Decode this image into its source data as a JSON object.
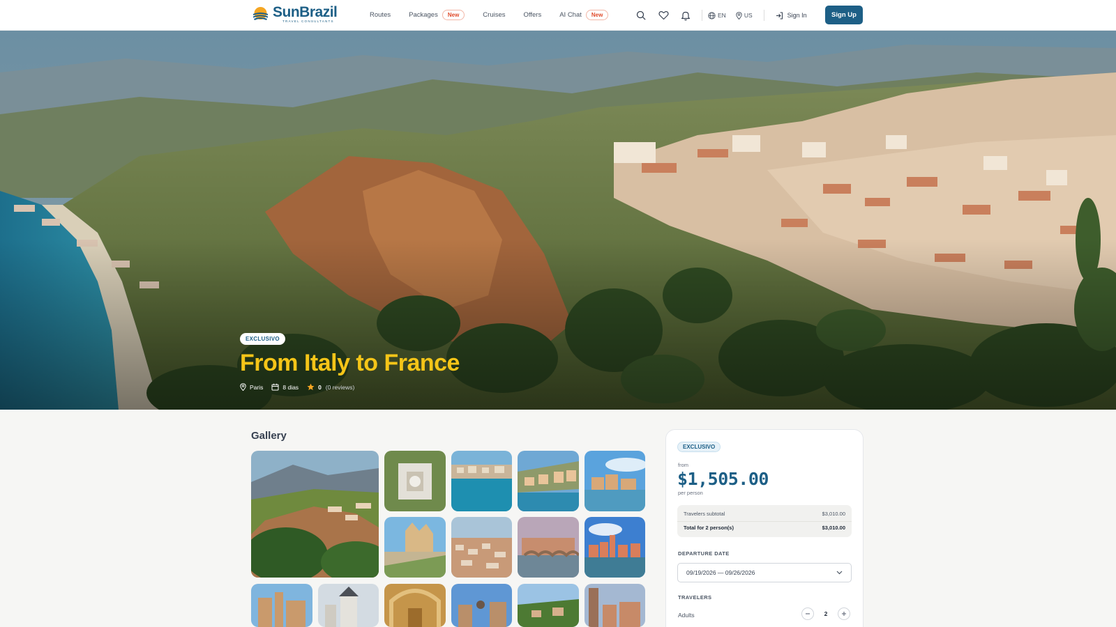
{
  "header": {
    "logo": {
      "name_part1": "Sun",
      "name_part2": "Brazil",
      "tagline": "TRAVEL CONSULTANTS"
    },
    "nav": [
      {
        "label": "Routes",
        "badge": null
      },
      {
        "label": "Packages",
        "badge": "New"
      },
      {
        "label": "Cruises",
        "badge": null
      },
      {
        "label": "Offers",
        "badge": null
      },
      {
        "label": "AI Chat",
        "badge": "New"
      }
    ],
    "icons": [
      "search-icon",
      "heart-icon",
      "bell-icon"
    ],
    "language": "EN",
    "region": "US",
    "sign_in": "Sign In",
    "sign_up": "Sign Up",
    "accent": "#1d5f86",
    "badge_color": "#e04b2a"
  },
  "hero": {
    "badge": "EXCLUSIVO",
    "title": "From Italy to France",
    "location": "Paris",
    "duration": "8 dias",
    "rating": "0",
    "reviews": "(0 reviews)",
    "title_color": "#f5c518"
  },
  "gallery": {
    "title": "Gallery",
    "image_count": 16
  },
  "booking": {
    "badge": "EXCLUSIVO",
    "from_label": "from",
    "price": "$1,505.00",
    "per_person": "per person",
    "travelers_subtotal_label": "Travelers subtotal",
    "travelers_subtotal_value": "$3,010.00",
    "total_label": "Total for 2 person(s)",
    "total_value": "$3,010.00",
    "departure_label": "DEPARTURE DATE",
    "departure_value": "09/19/2026 — 09/26/2026",
    "travelers_label": "TRAVELERS",
    "adults_label": "Adults",
    "adults_value": "2"
  }
}
